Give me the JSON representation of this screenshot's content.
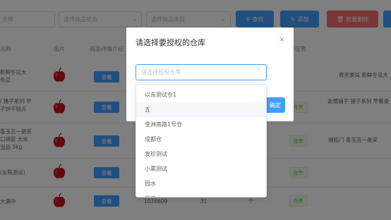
{
  "toolbar": {
    "name_placeholder": "名称",
    "status_placeholder": "选择商品状态",
    "category_placeholder": "选择商品类目",
    "search_label": "查找",
    "add_label": "添加",
    "batch_delete_label": "批量删除"
  },
  "table": {
    "headers": {
      "name": "名称",
      "image": "图片",
      "detail": "商品详情介绍",
      "on_sale": "否在售"
    },
    "rows": [
      {
        "name_lines": [
          "新鲜冬瓜大",
          "冬瓜"
        ],
        "view": "查看",
        "status": "",
        "desc": "寿天果局 新鲜冬瓜大"
      },
      {
        "name_lines": [
          "/ 猪子系列 早",
          "子饼干糕点"
        ],
        "view": "查看",
        "status": "在售",
        "desc": "盐儒铺子 猪子系列 早餐食"
      },
      {
        "name_lines": [
          "香玉吉一是采",
          "口袋装 大米",
          "当品 5kg"
        ],
        "view": "查看",
        "status": "在售",
        "desc": "福临门 香玉吉一是采"
      },
      {
        "name_lines": [
          "(友陈测试)"
        ],
        "view": "查看",
        "status": "在售",
        "desc": ""
      },
      {
        "name_lines": [
          "大遇华"
        ],
        "view": "查看",
        "status": "在售",
        "desc": "",
        "code": "1036609",
        "count": "31",
        "unit": "个"
      }
    ]
  },
  "dialog": {
    "title": "请选择要授权的仓库",
    "close": "×",
    "select_placeholder": "请选择授权仓库",
    "confirm_label": "确定"
  },
  "dropdown": {
    "options": [
      "以东测试仓1",
      "五",
      "金洲南路1号仓",
      "成都仓",
      "发珍测试",
      "小票测试",
      "园水",
      "下二"
    ]
  },
  "colors": {
    "primary": "#409eff",
    "danger": "#f56c6c",
    "success": "#67c23a",
    "overlay": "rgba(0,0,0,0.5)"
  }
}
